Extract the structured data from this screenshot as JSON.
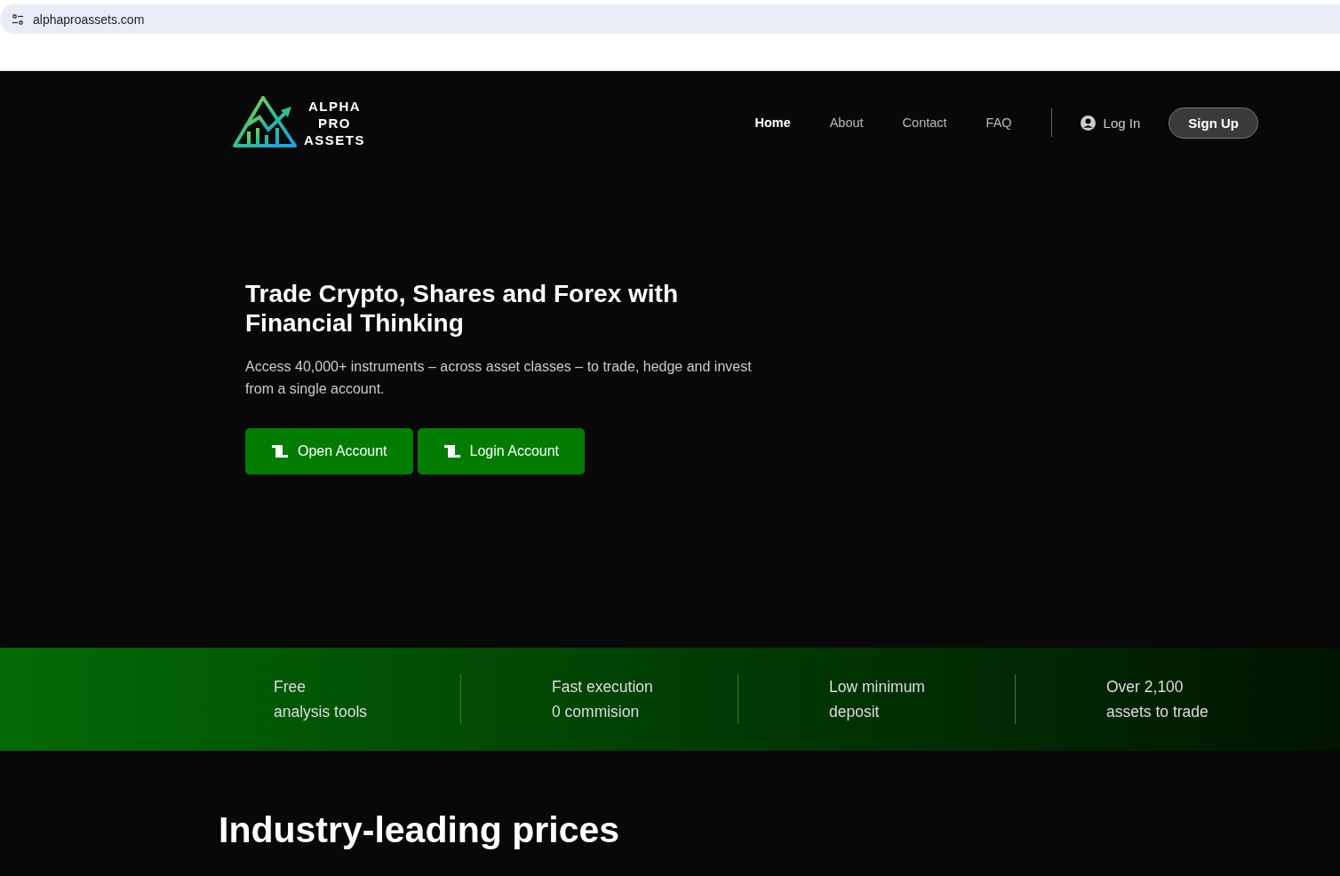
{
  "browser": {
    "url": "alphaproassets.com"
  },
  "logo": {
    "lines": [
      "ALPHA",
      "PRO",
      "ASSETS"
    ]
  },
  "nav": [
    {
      "label": "Home",
      "selected": true
    },
    {
      "label": "About",
      "selected": false
    },
    {
      "label": "Contact",
      "selected": false
    },
    {
      "label": "FAQ",
      "selected": false
    }
  ],
  "login": "Log In",
  "signup": "Sign Up",
  "hero": {
    "title": "Trade Crypto, Shares and Forex with Financial Thinking",
    "subtitle": "Access 40,000+ instruments – across asset classes – to trade, hedge and invest from a single account.",
    "buttons": [
      "Open Account",
      "Login Account"
    ]
  },
  "features": [
    {
      "lines": [
        "Free",
        "analysis tools"
      ]
    },
    {
      "lines": [
        "Fast execution",
        "0 commision"
      ]
    },
    {
      "lines": [
        "Low minimum",
        "deposit"
      ]
    },
    {
      "lines": [
        "Over 2,100",
        "assets to trade"
      ]
    }
  ],
  "section": {
    "title": "Industry-leading prices"
  }
}
